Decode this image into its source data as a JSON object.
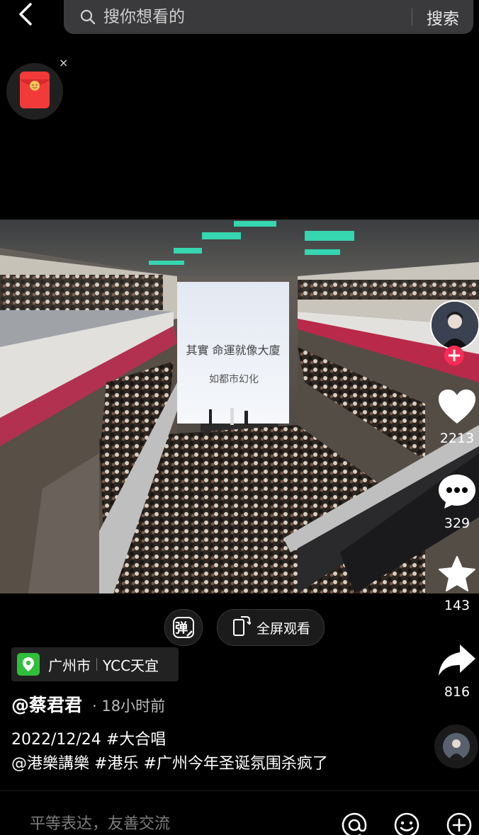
{
  "search": {
    "placeholder": "搜你想看的",
    "button_label": "搜索"
  },
  "icons": {
    "back": "chevron-left-icon",
    "search": "magnifier-icon",
    "red_packet": "red-envelope-icon",
    "close": "close-icon",
    "like": "heart-icon",
    "comment": "comment-bubble-icon",
    "favorite": "star-icon",
    "share": "share-arrow-icon",
    "danmu": "danmu-icon",
    "fullscreen": "rotate-screen-icon",
    "location": "location-pin-icon",
    "mention": "at-icon",
    "emoji": "emoji-icon",
    "add": "plus-circle-icon"
  },
  "video": {
    "screen_text_line1": "其實 命運就像大廈",
    "screen_text_line2": "如都市幻化"
  },
  "actions": {
    "follow_symbol": "+",
    "likes": "2213",
    "comments": "329",
    "favorites": "143",
    "shares": "816"
  },
  "controls": {
    "danmu_label": "弹",
    "fullscreen_label": "全屏观看"
  },
  "location": {
    "city": "广州市",
    "place": "YCC天宜"
  },
  "post": {
    "author": "@蔡君君",
    "time_ago": "· 18小时前",
    "date": "2022/12/24",
    "tag_choir": "#大合唱",
    "mention_account": "@港樂講樂",
    "tag_hk_music": "#港乐",
    "tag_christmas": "#广州今年圣诞氛围杀疯了"
  },
  "comment": {
    "placeholder": "平等表达，友善交流"
  },
  "colors": {
    "background": "#000000",
    "search_bg": "#3a3a3c",
    "follow_red": "#fe2c55",
    "location_green": "#2fbf3a",
    "red_packet": "#f23a3a"
  },
  "close_symbol": "×"
}
